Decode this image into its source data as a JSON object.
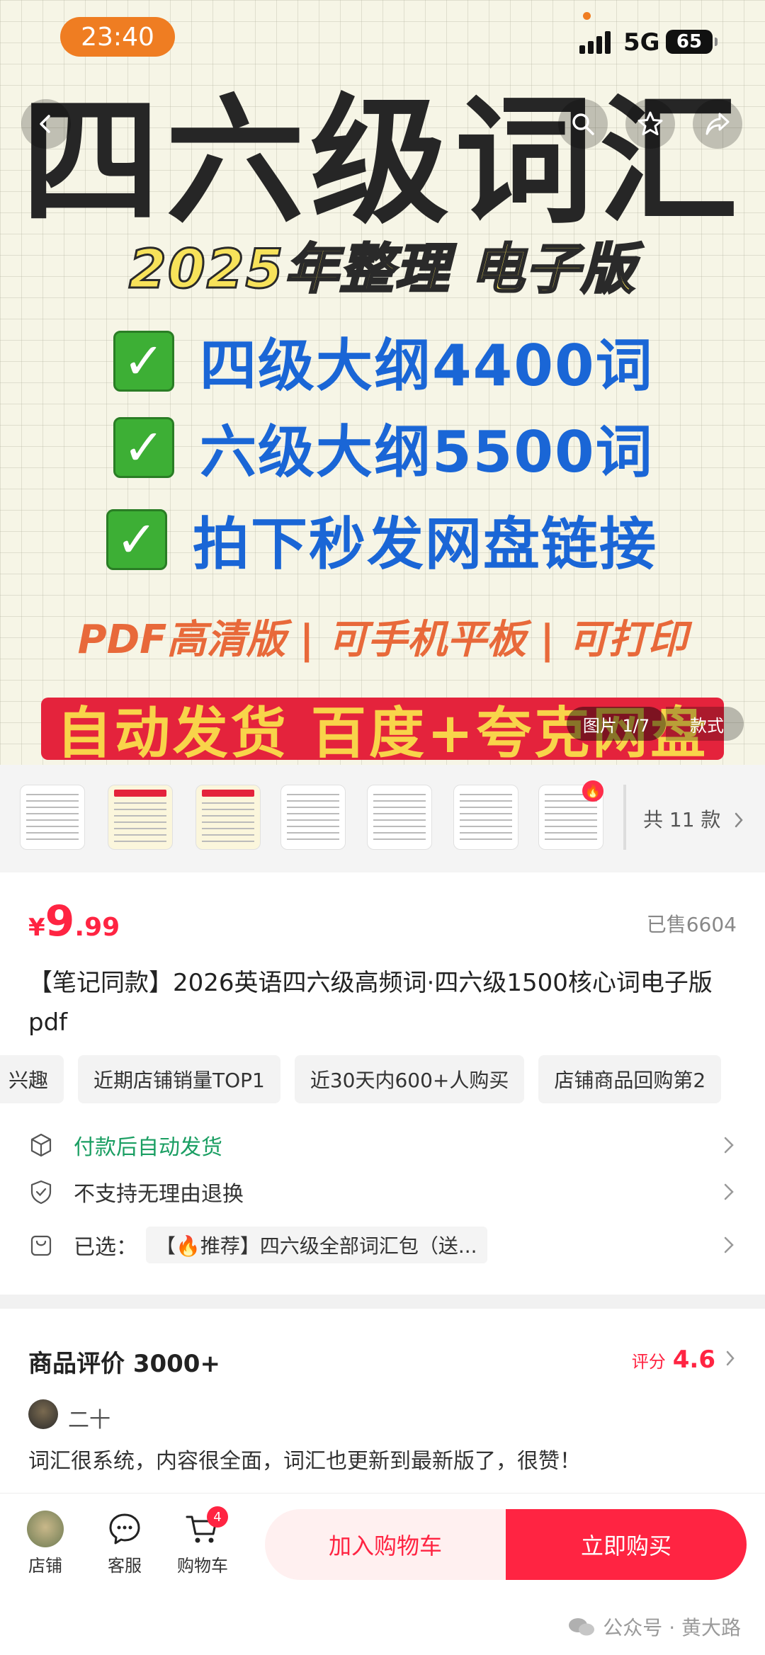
{
  "status_bar": {
    "time": "23:40",
    "network": "5G",
    "battery": "65"
  },
  "hero": {
    "title": "四六级词汇",
    "subtitle": "2025年整理 电子版",
    "lines": [
      "四级大纲4400词",
      "六级大纲5500词",
      "拍下秒发网盘链接"
    ],
    "check_glyph": "✓",
    "format_line": "PDF高清版 | 可手机平板 | 可打印",
    "banner": "自动发货  百度+夸克网盘",
    "image_counter": "图片 1/7",
    "style_chip": "款式"
  },
  "icons": {
    "back": "chevron-left-icon",
    "search": "search-icon",
    "favorite": "star-icon",
    "share": "share-icon",
    "shop": "shop-avatar",
    "service": "chat-icon",
    "cart": "cart-icon"
  },
  "thumbs": {
    "total": "共 11 款",
    "fire": "🔥"
  },
  "product": {
    "currency": "¥",
    "price_int": "9",
    "price_dec": ".99",
    "sold": "已售6604",
    "title": "【笔记同款】2026英语四六级高频词·四六级1500核心词电子版pdf",
    "tags": [
      "兴趣",
      "近期店铺销量TOP1",
      "近30天内600+人购买",
      "店铺商品回购第2"
    ],
    "rows": {
      "delivery": "付款后自动发货",
      "return_policy": "不支持无理由退换",
      "selected_label": "已选：",
      "selected_value": "【🔥推荐】四六级全部词汇包（送..."
    }
  },
  "reviews": {
    "title": "商品评价 3000+",
    "rating_label": "评分",
    "rating_value": "4.6",
    "user": "二十",
    "text": "词汇很系统，内容很全面，词汇也更新到最新版了，很赞！"
  },
  "bottom_bar": {
    "shop": "店铺",
    "service": "客服",
    "cart": "购物车",
    "cart_count": "4",
    "add_to_cart": "加入购物车",
    "buy_now": "立即购买"
  },
  "watermark": "公众号 · 黄大路",
  "colors": {
    "accent": "#ff2442",
    "green": "#1a9e62",
    "status_orange": "#ef7d22"
  }
}
